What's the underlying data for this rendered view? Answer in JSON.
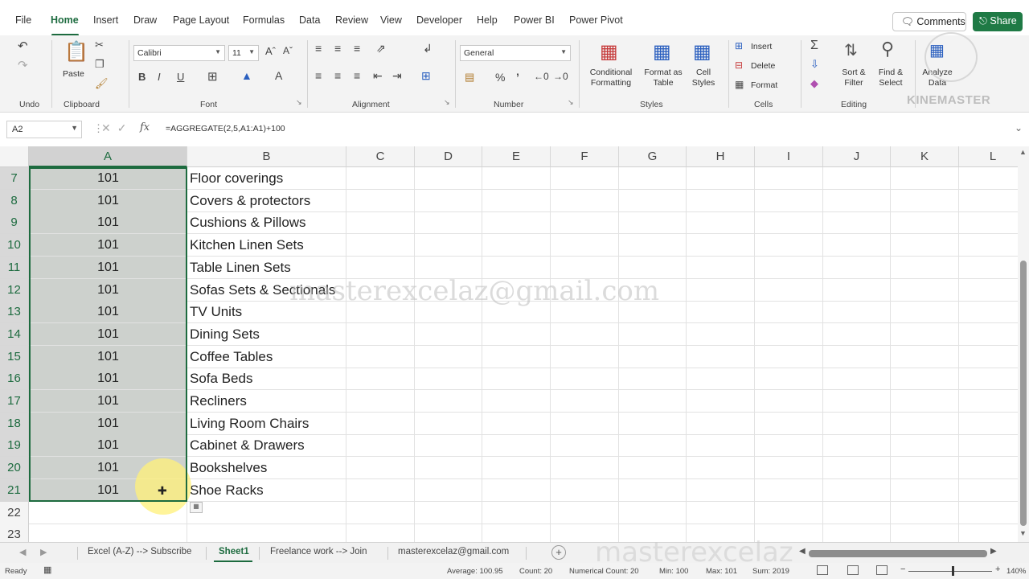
{
  "menu": {
    "tabs": [
      "File",
      "Home",
      "Insert",
      "Draw",
      "Page Layout",
      "Formulas",
      "Data",
      "Review",
      "View",
      "Developer",
      "Help",
      "Power BI",
      "Power Pivot"
    ],
    "comments_label": "Comments",
    "share_label": "Share"
  },
  "ribbon": {
    "groups": {
      "undo": "Undo",
      "clipboard": "Clipboard",
      "font": "Font",
      "alignment": "Alignment",
      "number": "Number",
      "styles": "Styles",
      "cells": "Cells",
      "editing": "Editing"
    },
    "paste_label": "Paste",
    "font_name": "Calibri",
    "font_size": "11",
    "number_format": "General",
    "conditional_formatting": [
      "Conditional",
      "Formatting"
    ],
    "format_as_table": [
      "Format as",
      "Table"
    ],
    "cell_styles": [
      "Cell",
      "Styles"
    ],
    "insert_label": "Insert",
    "delete_label": "Delete",
    "format_label": "Format",
    "sort_filter": [
      "Sort &",
      "Filter"
    ],
    "find_select": [
      "Find &",
      "Select"
    ],
    "analyze_data": [
      "Analyze",
      "Data"
    ],
    "watermark_brand": "KINEMASTER",
    "icons": {
      "undo": "undo-icon",
      "redo": "redo-icon",
      "paste": "paste-icon",
      "cut": "scissors-icon",
      "copy": "copy-icon",
      "format_painter": "brush-icon",
      "bold": "bold-icon",
      "italic": "italic-icon",
      "underline": "underline-icon",
      "borders": "borders-icon",
      "fill_color": "fill-bucket-icon",
      "font_color": "font-color-icon",
      "autosum": "sigma-icon",
      "find": "magnifier-icon"
    }
  },
  "formula_bar": {
    "name_box": "A2",
    "fx": "fx",
    "formula": "=AGGREGATE(2,5,A1:A1)+100"
  },
  "sheet": {
    "columns": [
      "A",
      "B",
      "C",
      "D",
      "E",
      "F",
      "G",
      "H",
      "I",
      "J",
      "K",
      "L"
    ],
    "selected_column": "A",
    "rows": [
      {
        "num": "7",
        "a": "101",
        "b": "Floor coverings"
      },
      {
        "num": "8",
        "a": "101",
        "b": "Covers & protectors"
      },
      {
        "num": "9",
        "a": "101",
        "b": "Cushions & Pillows"
      },
      {
        "num": "10",
        "a": "101",
        "b": "Kitchen Linen Sets"
      },
      {
        "num": "11",
        "a": "101",
        "b": "Table Linen Sets"
      },
      {
        "num": "12",
        "a": "101",
        "b": "Sofas Sets & Sectionals"
      },
      {
        "num": "13",
        "a": "101",
        "b": "TV Units"
      },
      {
        "num": "14",
        "a": "101",
        "b": "Dining Sets"
      },
      {
        "num": "15",
        "a": "101",
        "b": "Coffee Tables"
      },
      {
        "num": "16",
        "a": "101",
        "b": "Sofa Beds"
      },
      {
        "num": "17",
        "a": "101",
        "b": "Recliners"
      },
      {
        "num": "18",
        "a": "101",
        "b": "Living Room Chairs"
      },
      {
        "num": "19",
        "a": "101",
        "b": "Cabinet & Drawers"
      },
      {
        "num": "20",
        "a": "101",
        "b": "Bookshelves"
      },
      {
        "num": "21",
        "a": "101",
        "b": "Shoe Racks"
      },
      {
        "num": "22",
        "a": "",
        "b": ""
      },
      {
        "num": "23",
        "a": "",
        "b": ""
      }
    ],
    "watermark_email": "masterexcelaz@gmail.com"
  },
  "sheet_tabs": {
    "tabs": [
      "Excel (A-Z) --> Subscribe",
      "Sheet1",
      "Freelance work --> Join",
      "masterexcelaz@gmail.com"
    ],
    "active": "Sheet1",
    "add_label": "+",
    "watermark": "masterexcelaz"
  },
  "status": {
    "ready": "Ready",
    "average": "Average: 100.95",
    "count": "Count: 20",
    "numerical_count": "Numerical Count: 20",
    "min": "Min: 100",
    "max": "Max: 101",
    "sum": "Sum: 2019",
    "zoom": "140%"
  },
  "colors": {
    "accent": "#1d6b3f",
    "share_bg": "#1f7a45",
    "selection_fill": "#cdd1cd"
  }
}
